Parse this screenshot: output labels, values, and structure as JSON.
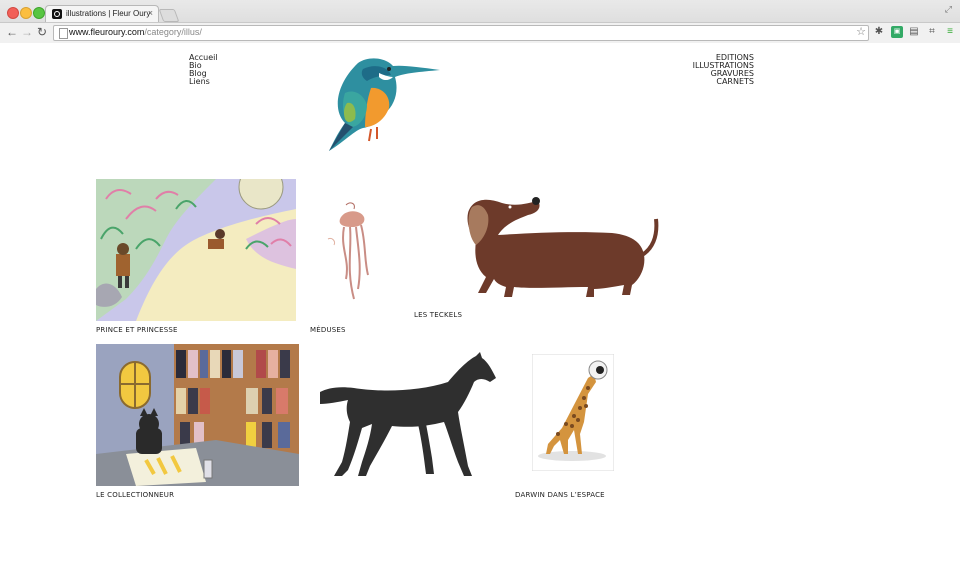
{
  "browser": {
    "tab_title": "illustrations | Fleur Oury",
    "tab_close": "×",
    "url_domain": "www.fleuroury.com",
    "url_path": "/category/illus/"
  },
  "nav_left": [
    "Accueil",
    "Bio",
    "Blog",
    "Liens"
  ],
  "nav_right": [
    "EDITIONS",
    "ILLUSTRATIONS",
    "GRAVURES",
    "CARNETS"
  ],
  "gallery": [
    {
      "caption": "PRINCE ET PRINCESSE"
    },
    {
      "caption": "MÉDUSES"
    },
    {
      "caption": "LES TECKELS"
    },
    {
      "caption": "LE COLLECTIONNEUR"
    },
    {
      "caption": ""
    },
    {
      "caption": "DARWIN DANS L’ESPACE"
    }
  ],
  "colors": {
    "accent_teal": "#1f8f8e",
    "dachshund": "#6d3a2a",
    "horse": "#2f2f2f"
  }
}
